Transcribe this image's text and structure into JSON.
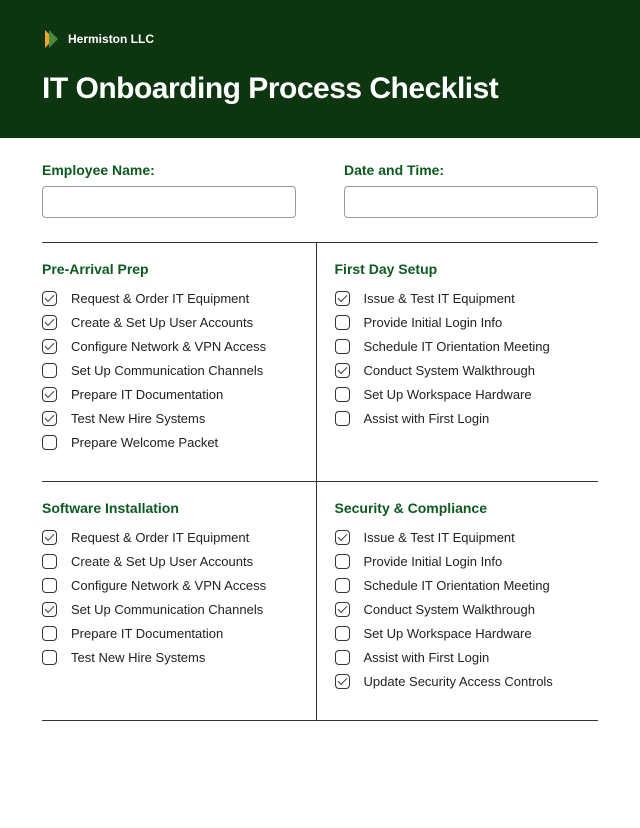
{
  "brand": "Hermiston LLC",
  "title": "IT Onboarding Process Checklist",
  "form": {
    "name_label": "Employee Name:",
    "date_label": "Date and Time:"
  },
  "sections": [
    {
      "title": "Pre-Arrival Prep",
      "items": [
        {
          "label": "Request & Order IT Equipment",
          "checked": true
        },
        {
          "label": "Create & Set Up User Accounts",
          "checked": true
        },
        {
          "label": "Configure Network & VPN Access",
          "checked": true
        },
        {
          "label": "Set Up Communication Channels",
          "checked": false
        },
        {
          "label": "Prepare IT Documentation",
          "checked": true
        },
        {
          "label": "Test New Hire Systems",
          "checked": true
        },
        {
          "label": "Prepare Welcome Packet",
          "checked": false
        }
      ]
    },
    {
      "title": "First Day Setup",
      "items": [
        {
          "label": "Issue & Test IT Equipment",
          "checked": true
        },
        {
          "label": "Provide Initial Login Info",
          "checked": false
        },
        {
          "label": "Schedule IT Orientation Meeting",
          "checked": false
        },
        {
          "label": "Conduct System Walkthrough",
          "checked": true
        },
        {
          "label": "Set Up Workspace Hardware",
          "checked": false
        },
        {
          "label": "Assist with First Login",
          "checked": false
        }
      ]
    },
    {
      "title": "Software Installation",
      "items": [
        {
          "label": "Request & Order IT Equipment",
          "checked": true
        },
        {
          "label": "Create & Set Up User Accounts",
          "checked": false
        },
        {
          "label": "Configure Network & VPN Access",
          "checked": false
        },
        {
          "label": "Set Up Communication Channels",
          "checked": true
        },
        {
          "label": "Prepare IT Documentation",
          "checked": false
        },
        {
          "label": "Test New Hire Systems",
          "checked": false
        }
      ]
    },
    {
      "title": "Security & Compliance",
      "items": [
        {
          "label": "Issue & Test IT Equipment",
          "checked": true
        },
        {
          "label": "Provide Initial Login Info",
          "checked": false
        },
        {
          "label": "Schedule IT Orientation Meeting",
          "checked": false
        },
        {
          "label": "Conduct System Walkthrough",
          "checked": true
        },
        {
          "label": "Set Up Workspace Hardware",
          "checked": false
        },
        {
          "label": "Assist with First Login",
          "checked": false
        },
        {
          "label": "Update Security Access Controls",
          "checked": true
        }
      ]
    }
  ]
}
